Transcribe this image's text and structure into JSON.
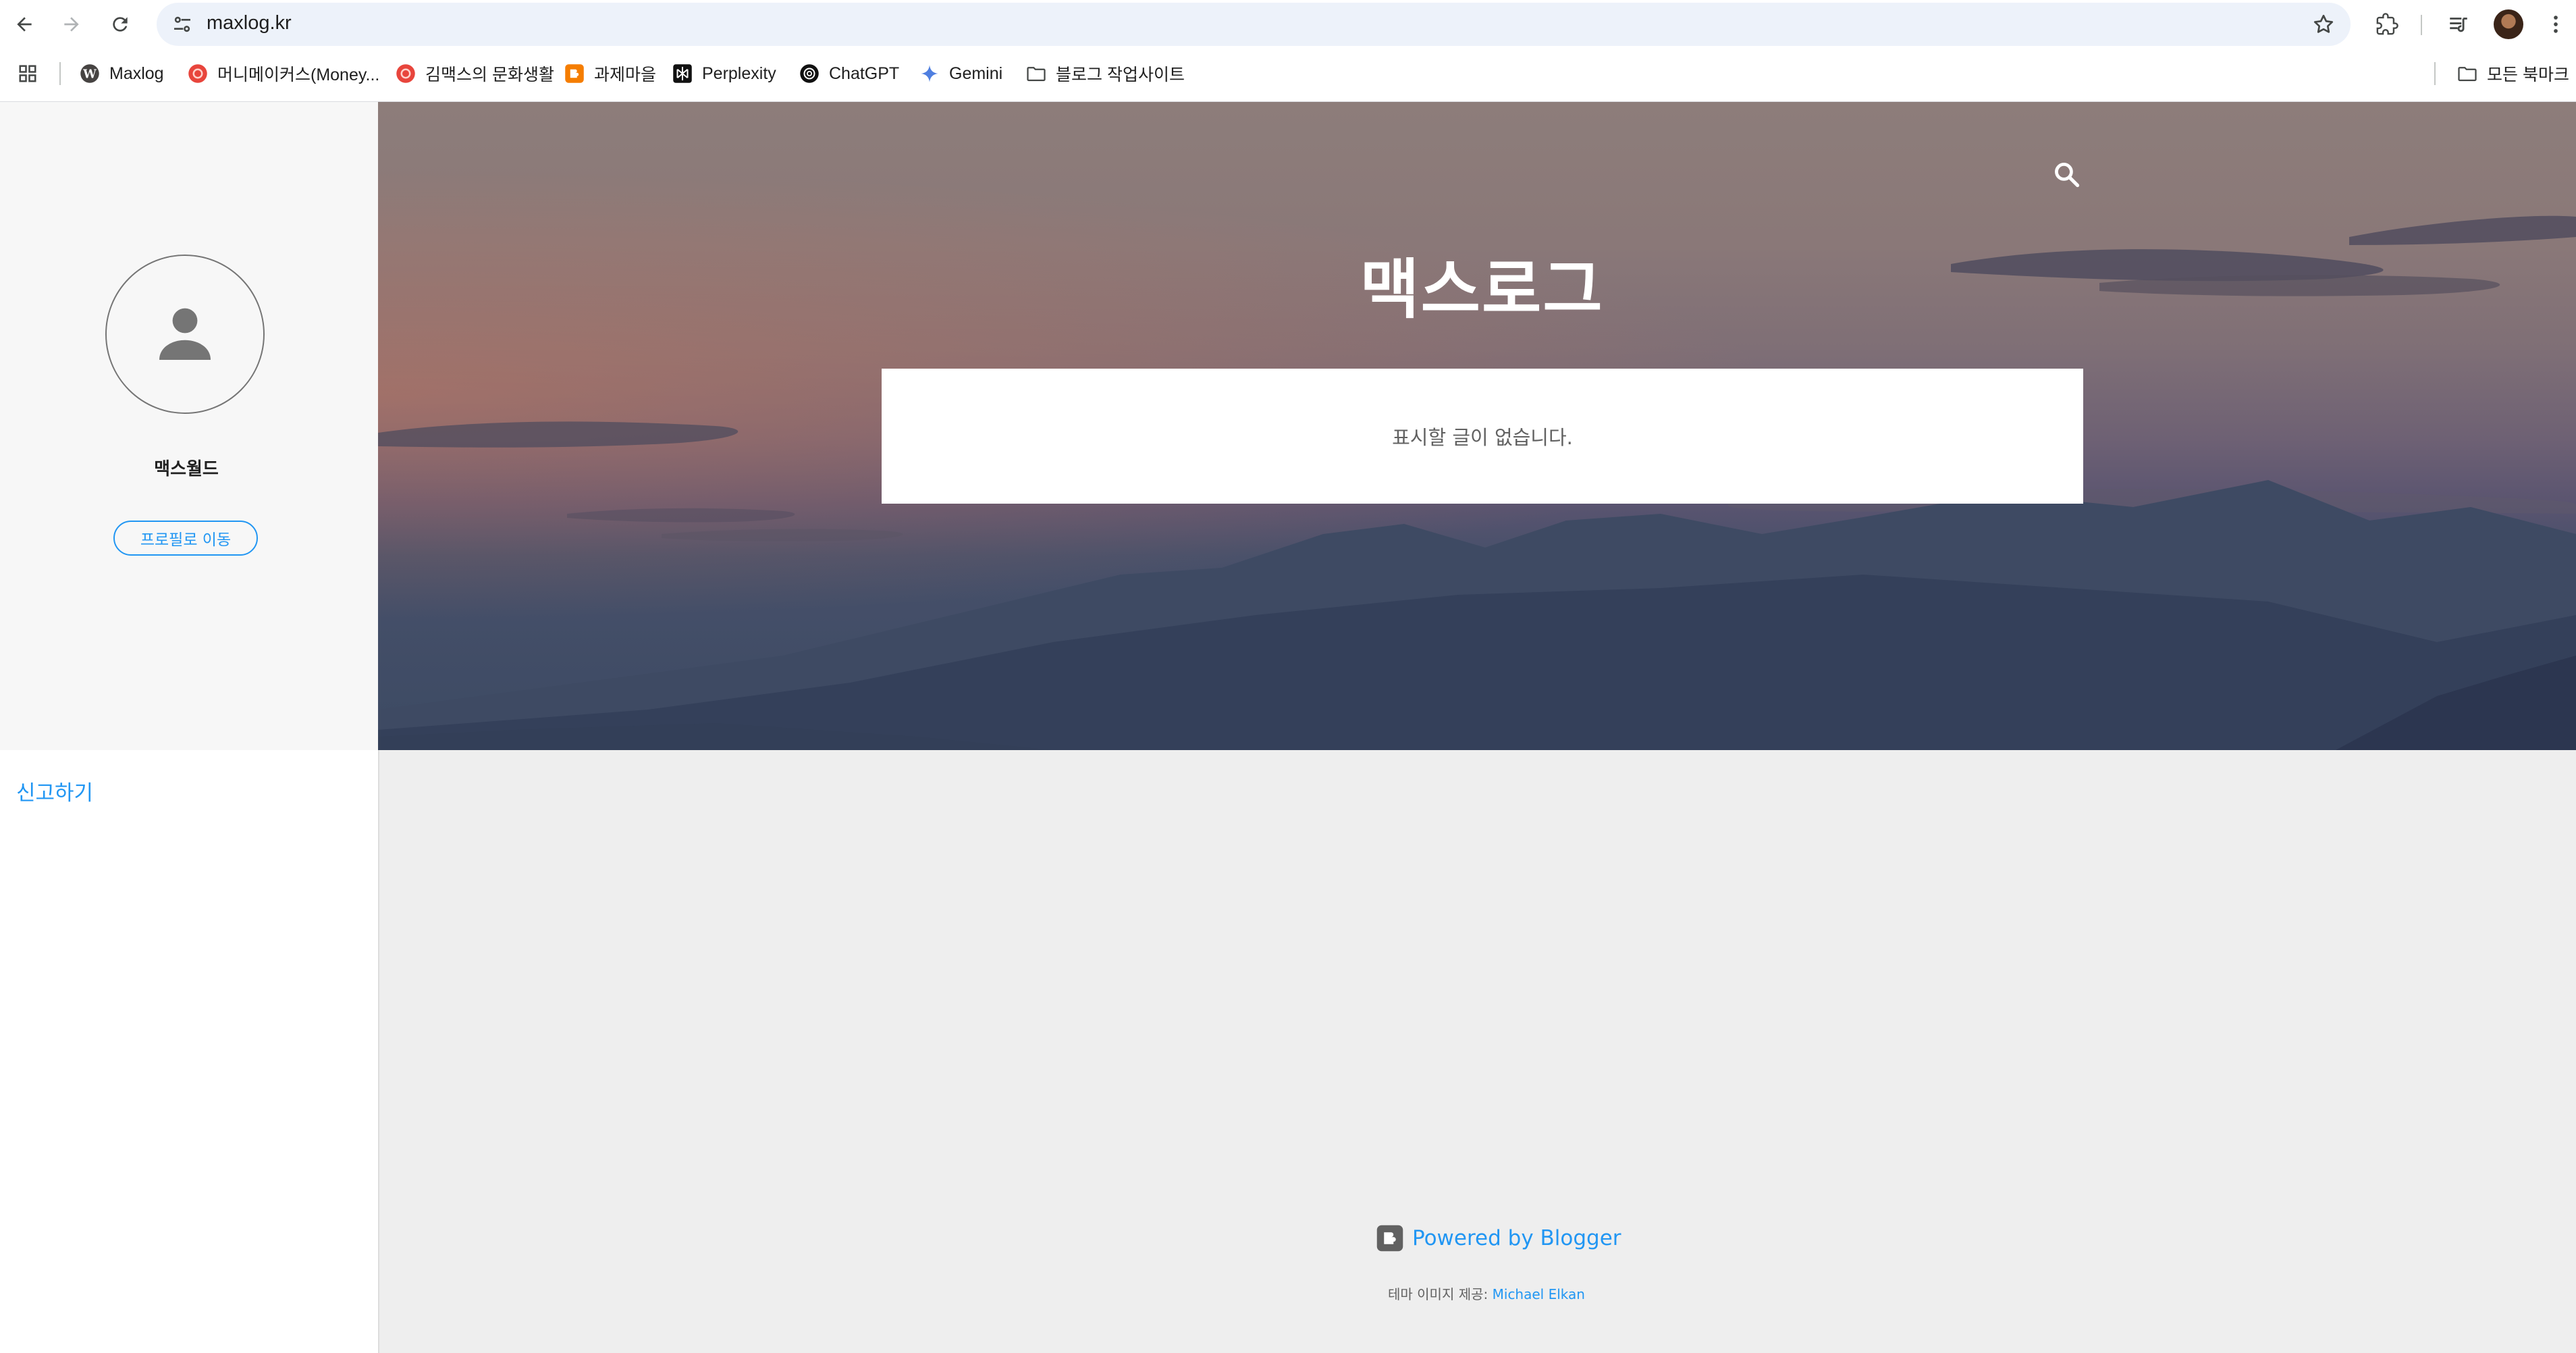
{
  "browser": {
    "url": "maxlog.kr",
    "bookmarks": [
      {
        "label": "Maxlog",
        "icon": "wordpress-icon"
      },
      {
        "label": "머니메이커스(Money...",
        "icon": "money-icon"
      },
      {
        "label": "김맥스의 문화생활",
        "icon": "money-icon"
      },
      {
        "label": "과제마을",
        "icon": "blogger-icon"
      },
      {
        "label": "Perplexity",
        "icon": "perplexity-icon"
      },
      {
        "label": "ChatGPT",
        "icon": "chatgpt-icon"
      },
      {
        "label": "Gemini",
        "icon": "gemini-icon"
      },
      {
        "label": "블로그 작업사이트",
        "icon": "folder-icon"
      }
    ],
    "all_bookmarks": "모든 북마크"
  },
  "sidebar": {
    "profile_name": "맥스월드",
    "profile_button": "프로필로 이동",
    "report_link": "신고하기"
  },
  "header": {
    "blog_title": "맥스로그",
    "empty_message": "표시할 글이 없습니다."
  },
  "footer": {
    "powered_by": "Powered by Blogger",
    "theme_credit_prefix": "테마 이미지 제공: ",
    "theme_credit_author": "Michael Elkan"
  },
  "colors": {
    "accent": "#2196f3",
    "omnibox": "#edf2fa",
    "page_bg": "#eeeeee"
  }
}
